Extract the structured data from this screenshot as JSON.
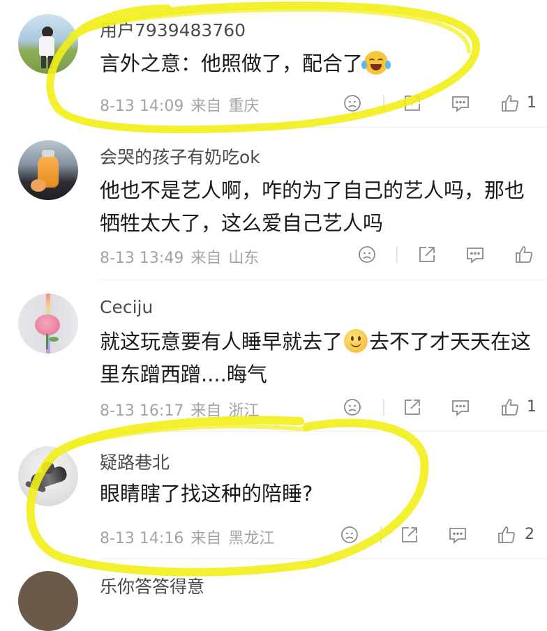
{
  "comments": [
    {
      "username": "用户7939483760",
      "text_before": "言外之意：他照做了，配合了",
      "text_after": "",
      "date": "8-13 14:09",
      "from": "来自",
      "location": "重庆",
      "likes": "1",
      "emoji": "laugh-cry-emoji"
    },
    {
      "username": "会哭的孩子有奶吃ok",
      "text_before": "他也不是艺人啊，咋的为了自己的艺人吗，那也牺牲太大了，这么爱自己艺人吗",
      "text_after": "",
      "date": "8-13 13:49",
      "from": "来自",
      "location": "山东",
      "likes": ""
    },
    {
      "username": "Ceciju",
      "text_before": "就这玩意要有人睡早就去了",
      "text_after": "去不了才天天在这里东蹭西蹭....晦气",
      "date": "8-13 16:17",
      "from": "来自",
      "location": "浙江",
      "likes": "1",
      "emoji": "smile-emoji"
    },
    {
      "username": "疑路巷北",
      "text_before": "眼睛瞎了找这种的陪睡?",
      "text_after": "",
      "date": "8-13 14:16",
      "from": "来自",
      "location": "黑龙江",
      "likes": "2"
    }
  ],
  "partial_next_username": "乐你答答得意",
  "colors": {
    "highlight": "#f2ee1a",
    "meta_text": "#a3a3a3",
    "username_text": "#4a4a4a",
    "body_text": "#1a1a1a"
  },
  "icons": [
    "dislike-icon",
    "share-icon",
    "reply-icon",
    "thumbs-up-icon"
  ]
}
